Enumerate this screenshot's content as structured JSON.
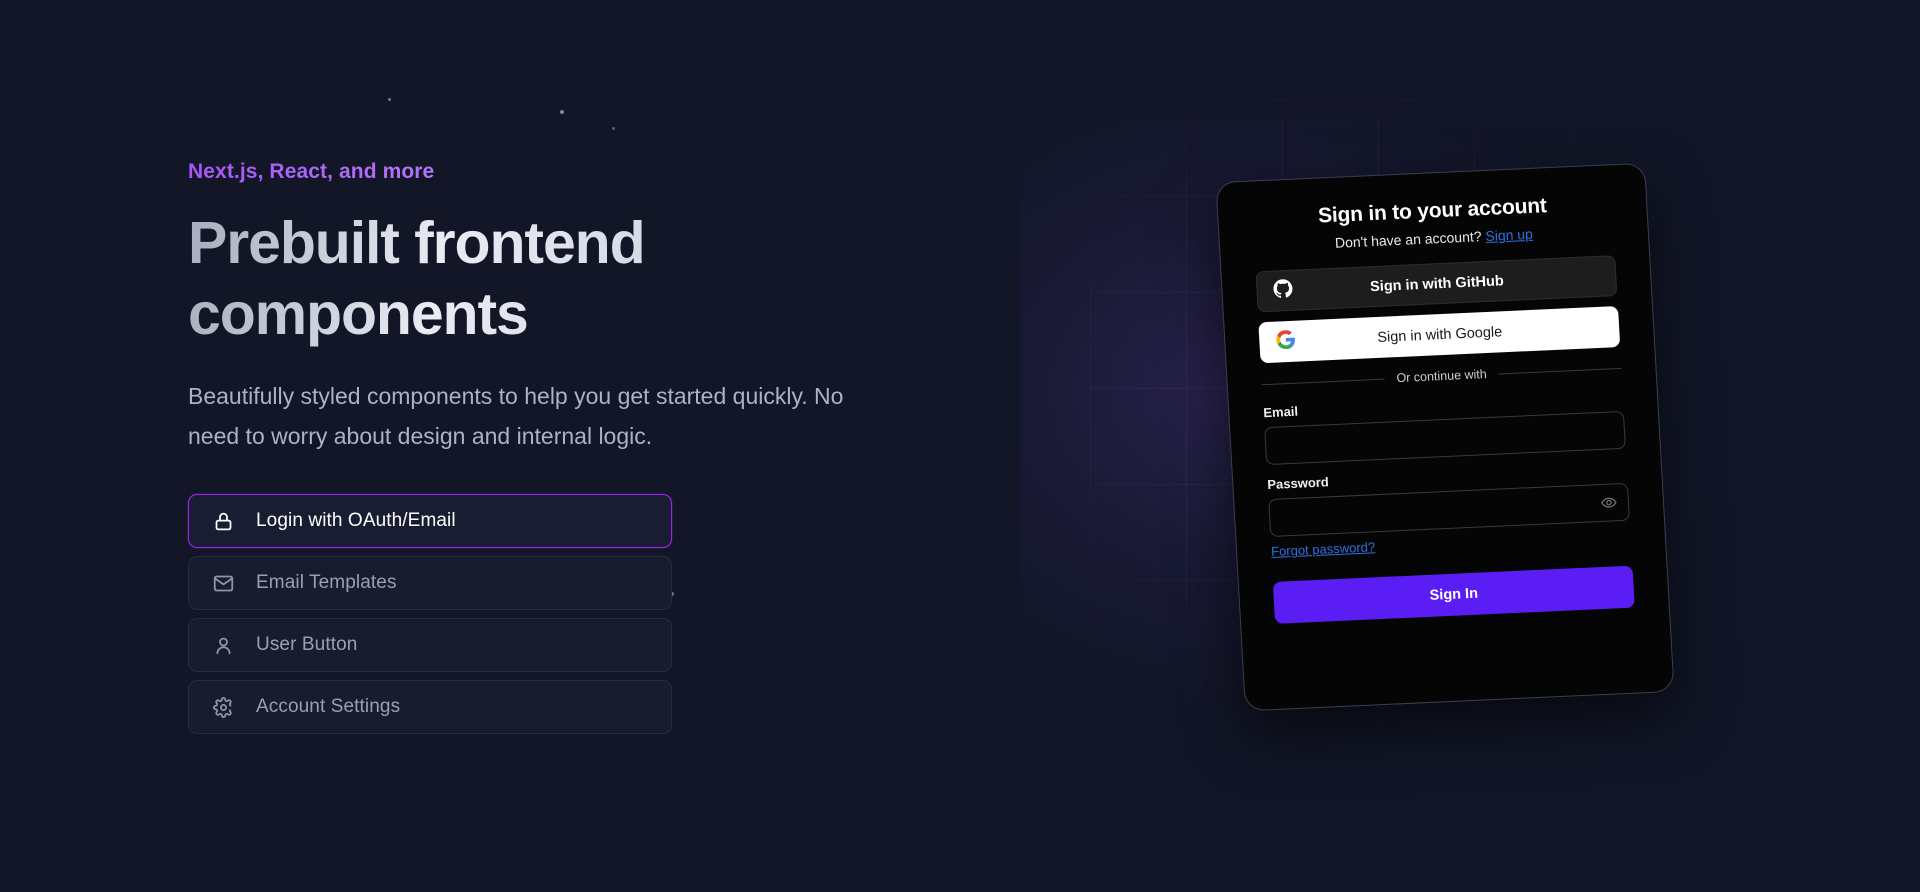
{
  "hero": {
    "eyebrow": "Next.js, React, and more",
    "headline": "Prebuilt frontend components",
    "subhead": "Beautifully styled components to help you get started quickly. No need to worry about design and internal logic.",
    "features": [
      {
        "label": "Login with OAuth/Email",
        "icon": "lock-icon",
        "active": true
      },
      {
        "label": "Email Templates",
        "icon": "envelope-icon",
        "active": false
      },
      {
        "label": "User Button",
        "icon": "user-icon",
        "active": false
      },
      {
        "label": "Account Settings",
        "icon": "gear-icon",
        "active": false
      }
    ]
  },
  "auth_card": {
    "title": "Sign in to your account",
    "sub_prefix": "Don't have an account? ",
    "signup_label": "Sign up",
    "github_button": "Sign in with GitHub",
    "google_button": "Sign in with Google",
    "divider_text": "Or continue with",
    "email_label": "Email",
    "email_value": "",
    "email_placeholder": "",
    "password_label": "Password",
    "password_value": "",
    "password_placeholder": "",
    "forgot_label": "Forgot password?",
    "submit_label": "Sign In",
    "icons": {
      "github": "github-icon",
      "google": "google-icon",
      "eye": "eye-icon"
    }
  },
  "colors": {
    "background": "#121627",
    "accent_purple": "#a020f0",
    "brand_violet": "#5a1ef5",
    "link_blue": "#2f6fe4",
    "eyebrow_from": "#a855f7",
    "eyebrow_to": "#c3b4fb"
  }
}
